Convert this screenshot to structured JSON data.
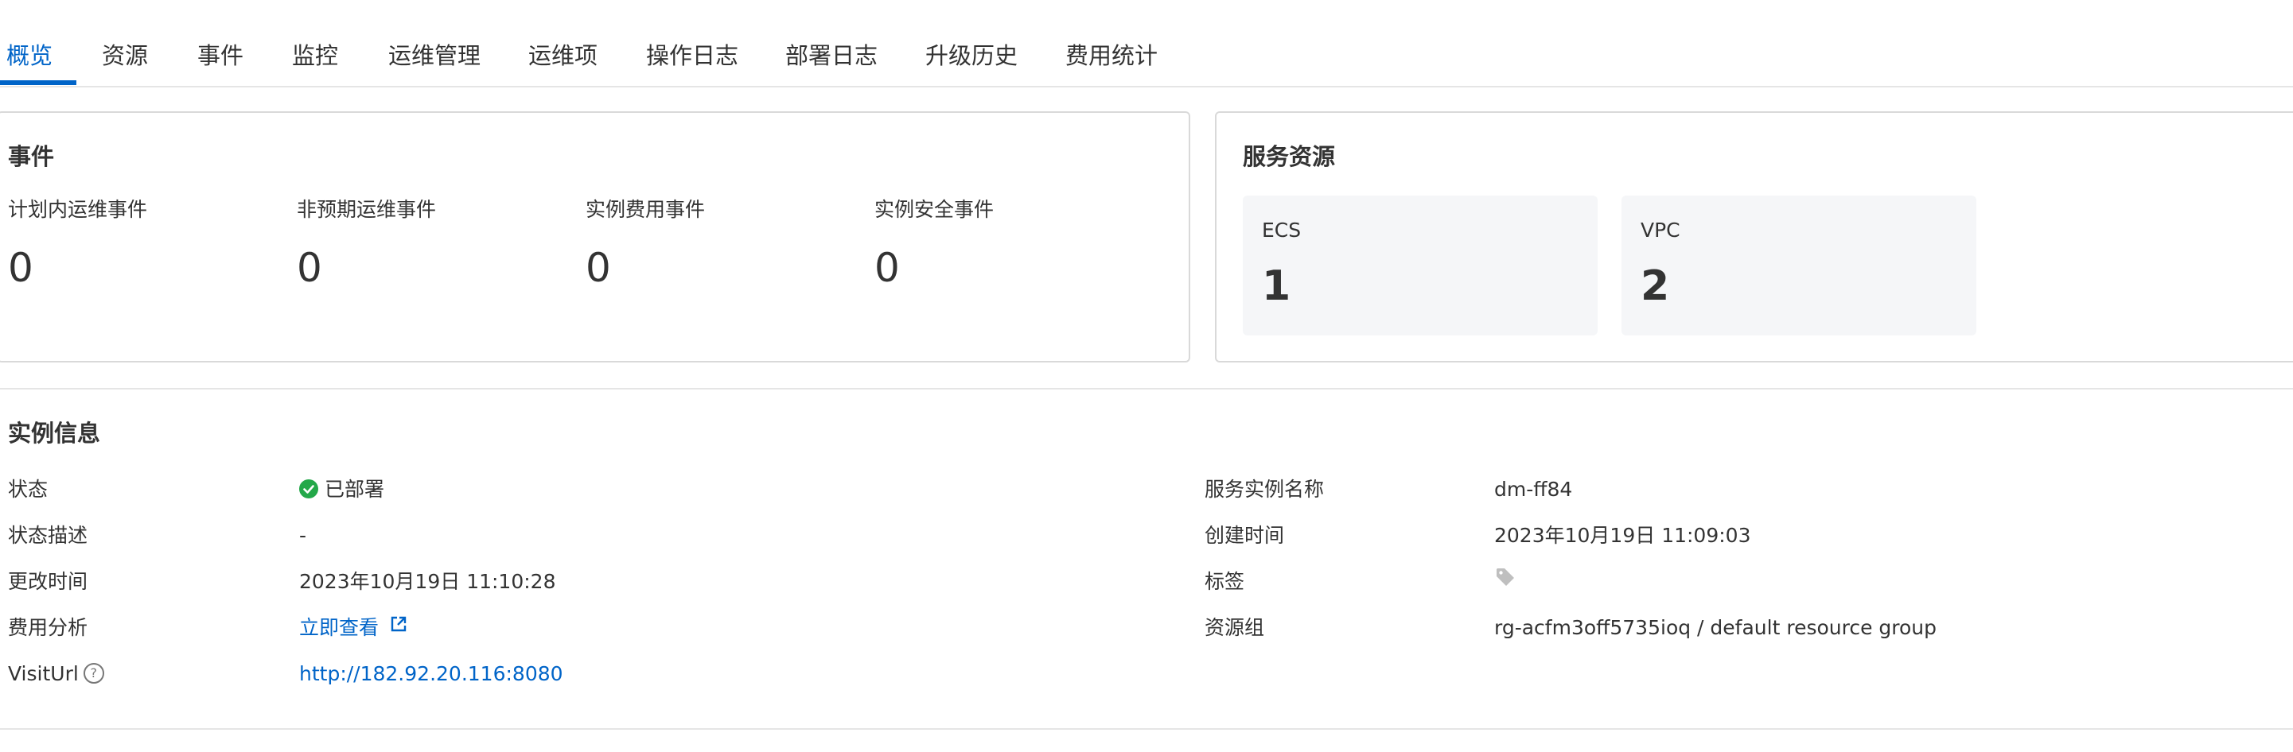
{
  "tabs": [
    "概览",
    "资源",
    "事件",
    "监控",
    "运维管理",
    "运维项",
    "操作日志",
    "部署日志",
    "升级历史",
    "费用统计"
  ],
  "active_tab": "概览",
  "events_card": {
    "title": "事件",
    "items": [
      {
        "label": "计划内运维事件",
        "value": "0"
      },
      {
        "label": "非预期运维事件",
        "value": "0"
      },
      {
        "label": "实例费用事件",
        "value": "0"
      },
      {
        "label": "实例安全事件",
        "value": "0"
      }
    ]
  },
  "resources_card": {
    "title": "服务资源",
    "items": [
      {
        "label": "ECS",
        "value": "1"
      },
      {
        "label": "VPC",
        "value": "2"
      }
    ]
  },
  "instance_info": {
    "title": "实例信息",
    "left": {
      "status_label": "状态",
      "status_value": "已部署",
      "status_desc_label": "状态描述",
      "status_desc_value": "-",
      "modified_label": "更改时间",
      "modified_value": "2023年10月19日 11:10:28",
      "cost_label": "费用分析",
      "cost_link": "立即查看",
      "visit_label": "VisitUrl",
      "visit_value": "http://182.92.20.116:8080"
    },
    "right": {
      "name_label": "服务实例名称",
      "name_value": "dm-ff84",
      "created_label": "创建时间",
      "created_value": "2023年10月19日 11:09:03",
      "tags_label": "标签",
      "group_label": "资源组",
      "group_value": "rg-acfm3off5735ioq / default resource group"
    }
  },
  "icons": {
    "status": "check-circle-icon",
    "help": "question-circle-icon",
    "external": "external-link-icon",
    "tag": "tag-icon"
  },
  "colors": {
    "accent": "#0064c8",
    "success": "#23a849",
    "border": "#d9d9d9",
    "tile_bg": "#f5f6f8"
  }
}
